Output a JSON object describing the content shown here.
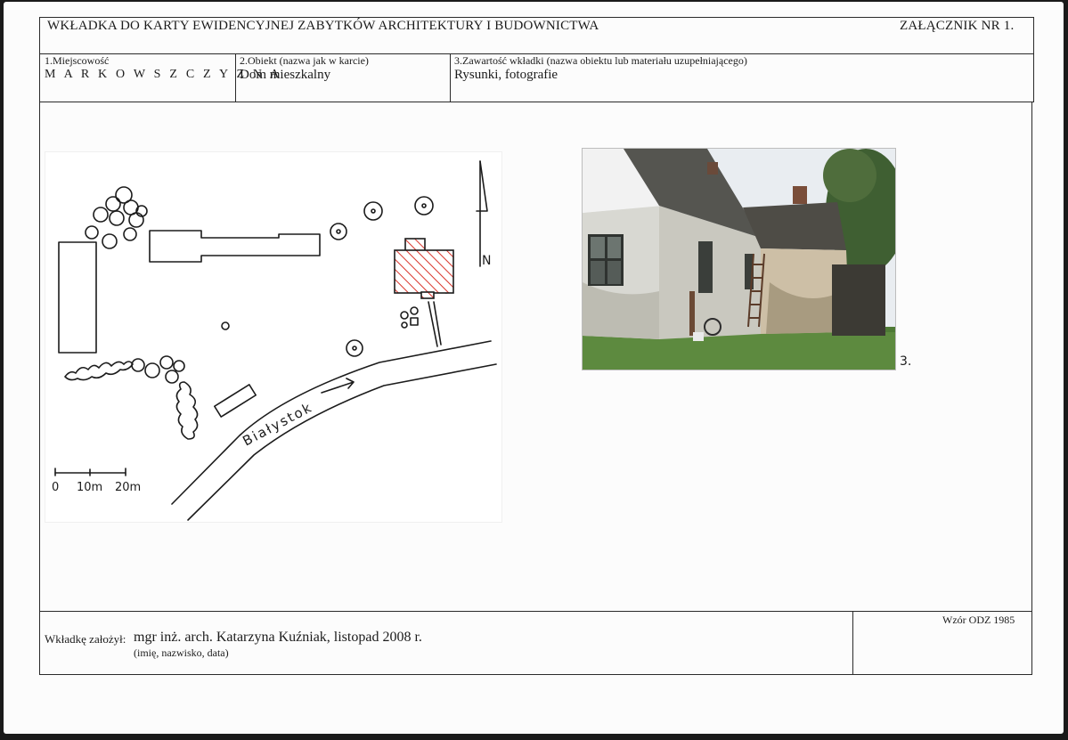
{
  "header": {
    "title": "WKŁADKA DO KARTY EWIDENCYJNEJ ZABYTKÓW ARCHITEKTURY I BUDOWNICTWA",
    "attachment": "ZAŁĄCZNIK NR 1."
  },
  "fields": {
    "locality_label": "1.Miejscowość",
    "locality_value": "M A R K O W S Z C Z Y Z N A",
    "object_label": "2.Obiekt (nazwa jak w karcie)",
    "object_value": "Dom mieszkalny",
    "content_label": "3.Zawartość wkładki (nazwa obiektu lub materiału uzupełniającego)",
    "content_value": "Rysunki, fotografie"
  },
  "plan": {
    "north_label": "N",
    "road_label": "Białystok",
    "scale_labels": [
      "0",
      "10m",
      "20m"
    ]
  },
  "photo": {
    "number_label": "3."
  },
  "footer": {
    "created_by_label": "Wkładkę założył:",
    "created_by_value": "mgr inż. arch. Katarzyna Kuźniak, listopad 2008 r.",
    "caption": "(imię, nazwisko, data)",
    "form_model": "Wzór ODZ 1985"
  },
  "colors": {
    "hatch": "#d9352b",
    "ink": "#1b1b1b"
  }
}
